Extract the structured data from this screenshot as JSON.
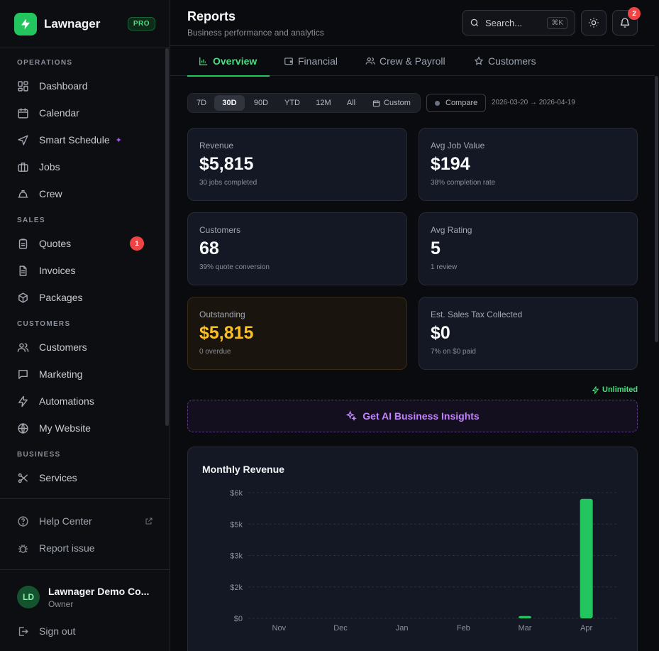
{
  "brand": {
    "name": "Lawnager",
    "badge": "PRO",
    "accent": "#22c55e"
  },
  "sidebar": {
    "sections": [
      {
        "label": "OPERATIONS",
        "items": [
          {
            "label": "Dashboard",
            "icon": "dashboard-icon"
          },
          {
            "label": "Calendar",
            "icon": "calendar-icon"
          },
          {
            "label": "Smart Schedule",
            "icon": "navigation-icon",
            "sparkle": true
          },
          {
            "label": "Jobs",
            "icon": "briefcase-icon"
          },
          {
            "label": "Crew",
            "icon": "hard-hat-icon"
          }
        ]
      },
      {
        "label": "SALES",
        "items": [
          {
            "label": "Quotes",
            "icon": "clipboard-icon",
            "badge": "1"
          },
          {
            "label": "Invoices",
            "icon": "file-text-icon"
          },
          {
            "label": "Packages",
            "icon": "package-icon"
          }
        ]
      },
      {
        "label": "CUSTOMERS",
        "items": [
          {
            "label": "Customers",
            "icon": "users-icon"
          },
          {
            "label": "Marketing",
            "icon": "message-icon"
          },
          {
            "label": "Automations",
            "icon": "zap-icon"
          },
          {
            "label": "My Website",
            "icon": "globe-icon"
          }
        ]
      },
      {
        "label": "BUSINESS",
        "items": [
          {
            "label": "Services",
            "icon": "scissors-icon"
          }
        ]
      }
    ],
    "help": "Help Center",
    "report": "Report issue",
    "user": {
      "initials": "LD",
      "name": "Lawnager Demo Co...",
      "role": "Owner"
    },
    "signout": "Sign out"
  },
  "header": {
    "title": "Reports",
    "subtitle": "Business performance and analytics",
    "search_placeholder": "Search...",
    "search_shortcut": "⌘K",
    "notifications": "2"
  },
  "tabs": [
    {
      "label": "Overview",
      "icon": "bar-chart-icon",
      "active": true
    },
    {
      "label": "Financial",
      "icon": "wallet-icon"
    },
    {
      "label": "Crew & Payroll",
      "icon": "users-icon"
    },
    {
      "label": "Customers",
      "icon": "star-icon"
    }
  ],
  "filters": {
    "ranges": [
      "7D",
      "30D",
      "90D",
      "YTD",
      "12M",
      "All",
      "Custom"
    ],
    "active": "30D",
    "compare": "Compare",
    "date_range": "2026-03-20 → 2026-04-19"
  },
  "kpis": [
    {
      "label": "Revenue",
      "value": "$5,815",
      "sub": "30 jobs completed"
    },
    {
      "label": "Avg Job Value",
      "value": "$194",
      "sub": "38% completion rate"
    },
    {
      "label": "Customers",
      "value": "68",
      "sub": "39% quote conversion"
    },
    {
      "label": "Avg Rating",
      "value": "5",
      "sub": "1 review"
    },
    {
      "label": "Outstanding",
      "value": "$5,815",
      "sub": "0 overdue",
      "warn": true
    },
    {
      "label": "Est. Sales Tax Collected",
      "value": "$0",
      "sub": "7% on $0 paid"
    }
  ],
  "ai": {
    "plan": "Unlimited",
    "button": "Get AI Business Insights"
  },
  "chart_data": {
    "type": "bar",
    "title": "Monthly Revenue",
    "categories": [
      "Nov",
      "Dec",
      "Jan",
      "Feb",
      "Mar",
      "Apr"
    ],
    "values": [
      0,
      0,
      0,
      0,
      110,
      5705
    ],
    "ylim": [
      0,
      6000
    ],
    "yticks": [
      "$0",
      "$2k",
      "$3k",
      "$5k",
      "$6k"
    ],
    "ytick_values": [
      0,
      1500,
      3000,
      4500,
      6000
    ],
    "bar_color": "#22c55e",
    "grid": true
  }
}
